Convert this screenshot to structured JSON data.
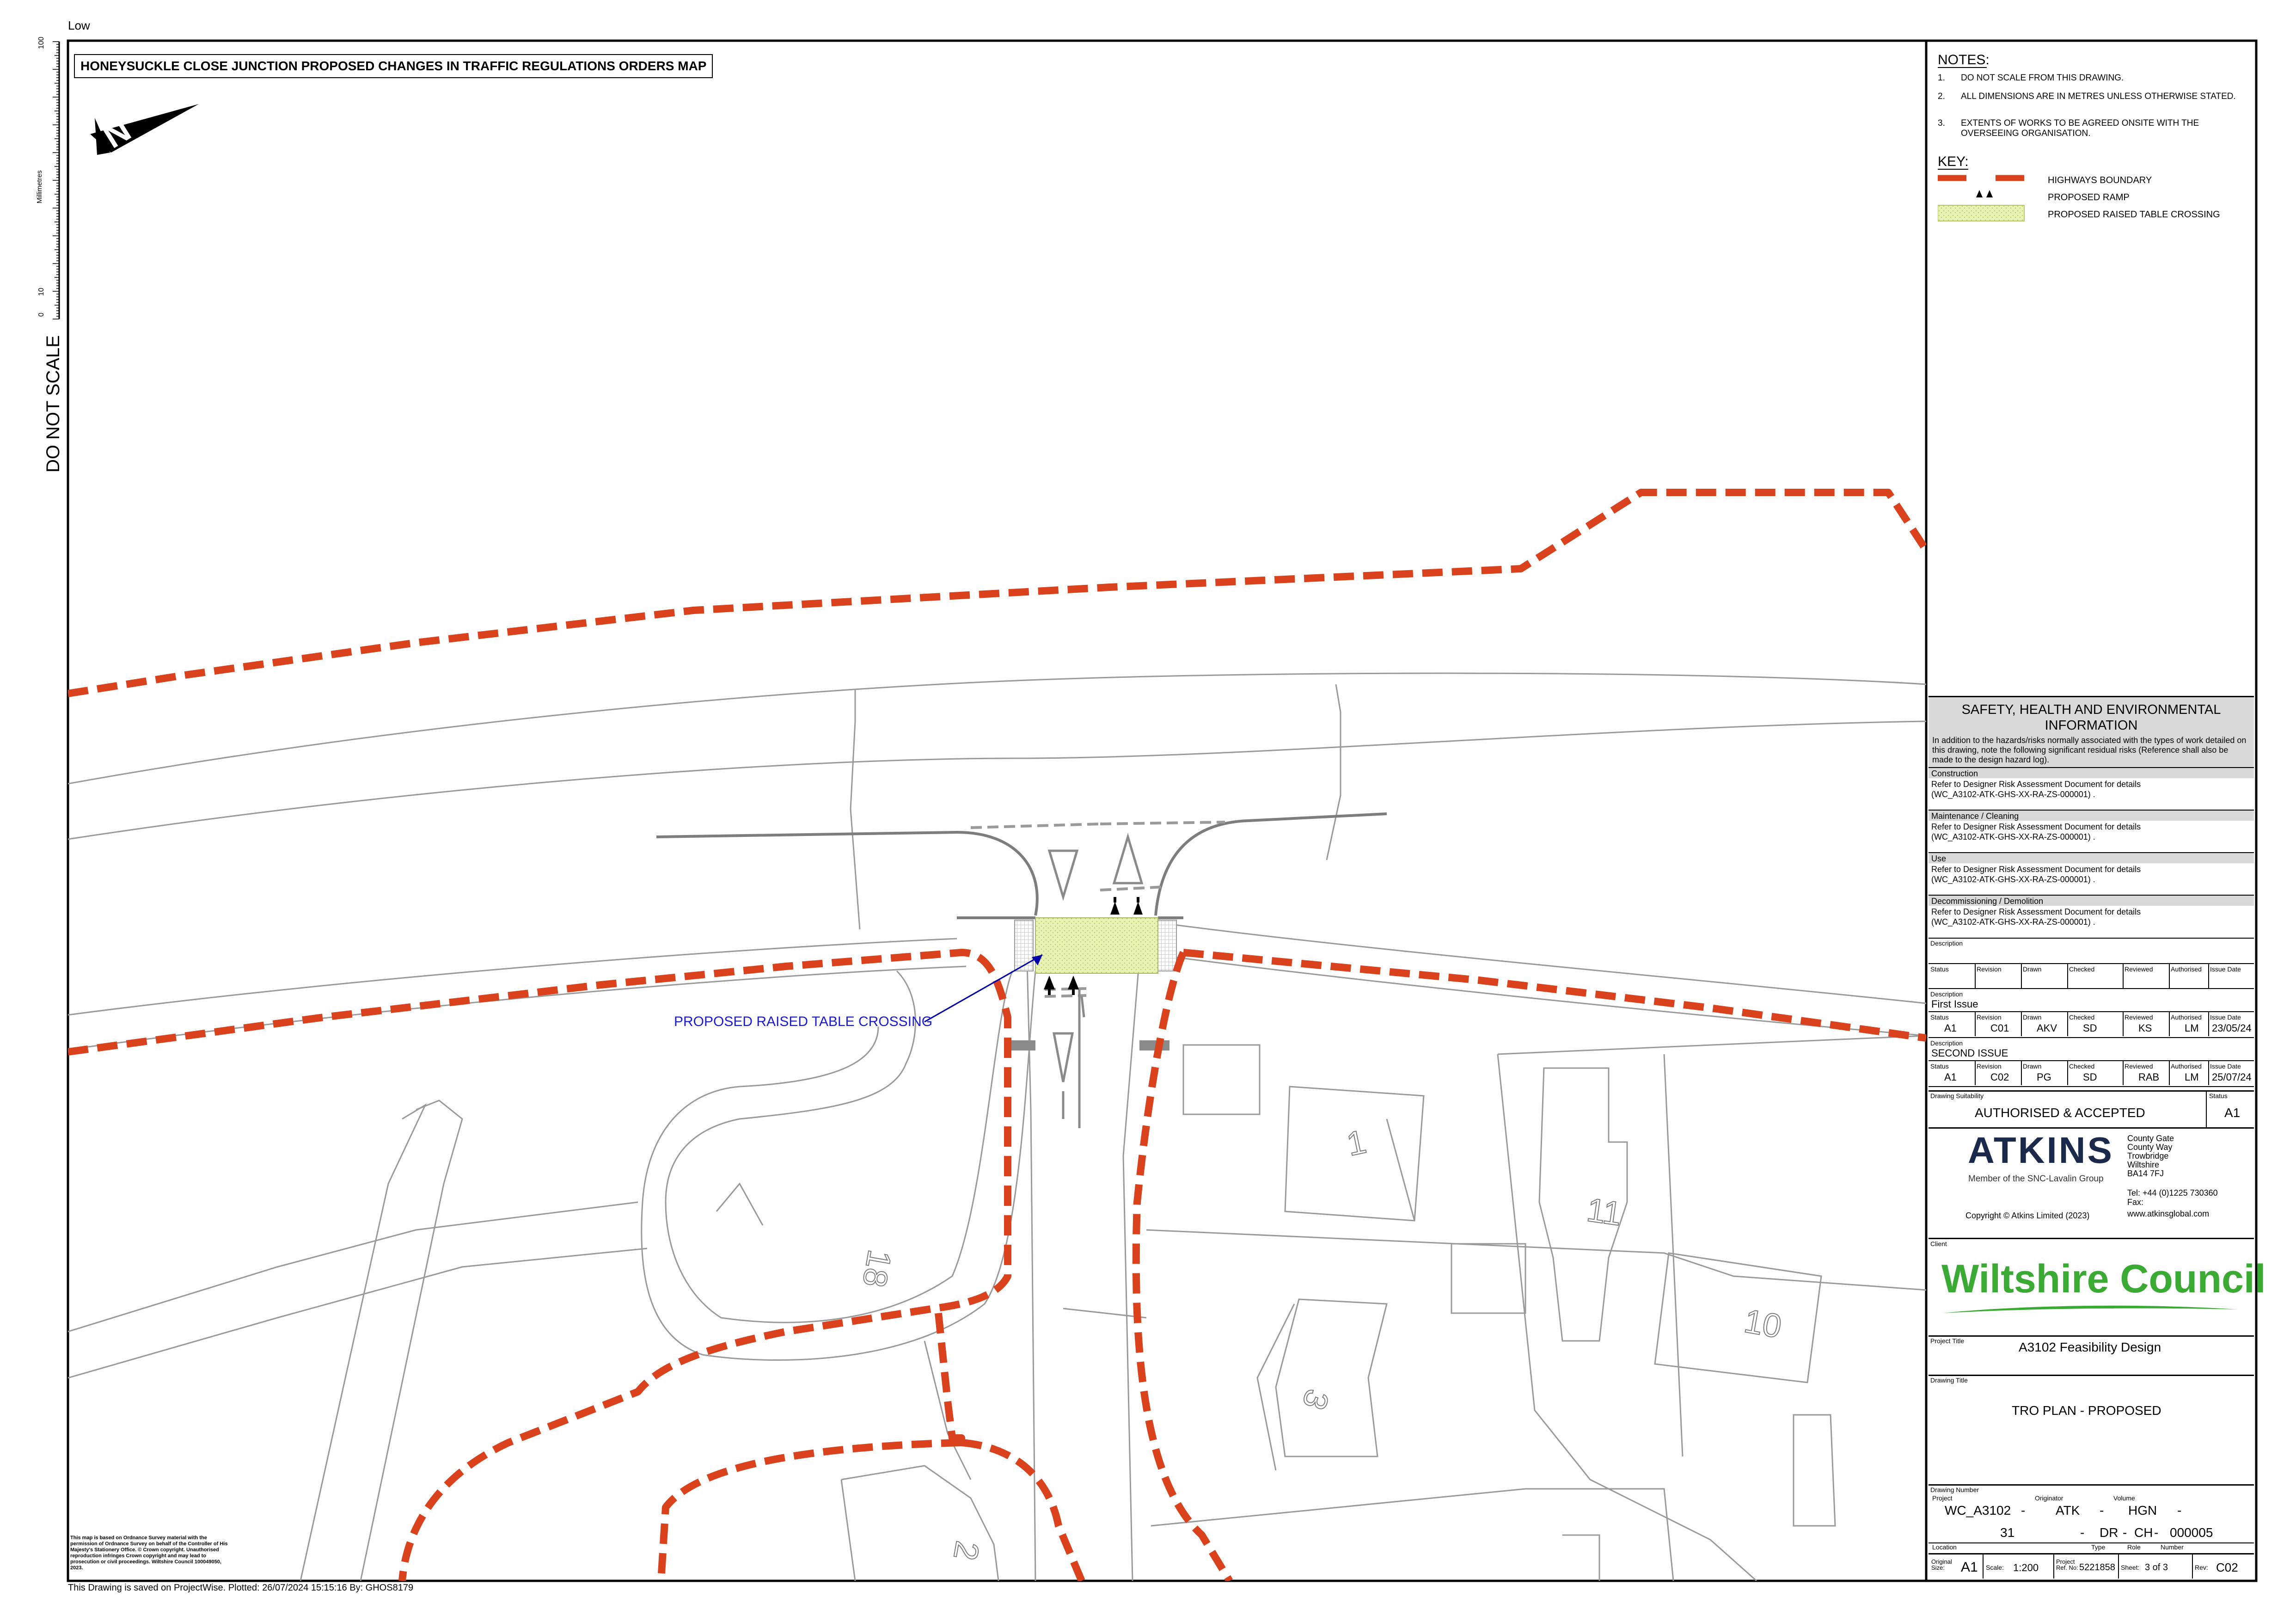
{
  "sheet": {
    "top_left_label": "Low",
    "do_not_scale": "DO NOT SCALE",
    "scale_bar_unit": "Millimetres",
    "scale_bar_ticks": [
      "100",
      "10",
      "0"
    ],
    "map_title": "HONEYSUCKLE CLOSE JUNCTION PROPOSED CHANGES IN TRAFFIC REGULATIONS ORDERS MAP",
    "north_arrow_letter": "N",
    "callout_label": "PROPOSED RAISED TABLE CROSSING",
    "footer": "This Drawing is saved on ProjectWise.   Plotted:  26/07/2024 15:15:16  By:  GHOS8179",
    "os_copyright": "This map is based on Ordnance Survey material with the permission of Ordnance Survey on behalf of the Controller of His Majesty's Stationery Office. © Crown copyright. Unauthorised reproduction infringes Crown copyright and may lead to prosecution or civil proceedings. Wiltshire Council 100049050, 2023.",
    "plot_numbers": [
      "1",
      "11",
      "10",
      "3",
      "2",
      "18"
    ]
  },
  "notes": {
    "heading": "NOTES:",
    "items": [
      {
        "num": "1.",
        "text": "DO NOT SCALE FROM THIS DRAWING."
      },
      {
        "num": "2.",
        "text": "ALL DIMENSIONS ARE IN METRES UNLESS OTHERWISE STATED."
      },
      {
        "num": "3.",
        "text": "EXTENTS OF WORKS TO BE AGREED ONSITE WITH THE OVERSEEING ORGANISATION."
      }
    ]
  },
  "key": {
    "heading": "KEY:",
    "items": [
      {
        "label": "HIGHWAYS BOUNDARY",
        "color": "#d9421c"
      },
      {
        "label": "PROPOSED RAMP",
        "color": "#000000"
      },
      {
        "label": "PROPOSED RAISED TABLE CROSSING",
        "color": "#e8f2b4"
      }
    ]
  },
  "she": {
    "heading": "SAFETY, HEALTH AND ENVIRONMENTAL INFORMATION",
    "intro": "In addition to the hazards/risks normally associated with the types of work detailed on this drawing, note the following significant residual risks (Reference shall also be made to the design hazard log).",
    "sections": [
      {
        "title": "Construction",
        "line1": "Refer to Designer Risk Assessment Document for details",
        "line2": "(WC_A3102-ATK-GHS-XX-RA-ZS-000001) ."
      },
      {
        "title": "Maintenance / Cleaning",
        "line1": "Refer to Designer Risk Assessment Document for details",
        "line2": "(WC_A3102-ATK-GHS-XX-RA-ZS-000001) ."
      },
      {
        "title": "Use",
        "line1": "Refer to Designer Risk Assessment Document for details",
        "line2": "(WC_A3102-ATK-GHS-XX-RA-ZS-000001) ."
      },
      {
        "title": "Decommissioning / Demolition",
        "line1": "Refer to Designer Risk Assessment Document for details",
        "line2": "(WC_A3102-ATK-GHS-XX-RA-ZS-000001) ."
      }
    ]
  },
  "revisions": {
    "desc_label": "Description",
    "headers": [
      "Status",
      "Revision",
      "Drawn",
      "Checked",
      "Reviewed",
      "Authorised",
      "Issue Date"
    ],
    "rows": [
      {
        "description": "First Issue",
        "values": [
          "A1",
          "C01",
          "AKV",
          "SD",
          "KS",
          "LM",
          "23/05/24"
        ]
      },
      {
        "description": "SECOND ISSUE",
        "values": [
          "A1",
          "C02",
          "PG",
          "SD",
          "RAB",
          "LM",
          "25/07/24"
        ]
      }
    ]
  },
  "suitability": {
    "label": "Drawing Suitability",
    "value": "AUTHORISED & ACCEPTED",
    "status_label": "Status",
    "status_value": "A1"
  },
  "atkins": {
    "logo": "ATKINS",
    "tagline": "Member of the SNC-Lavalin Group",
    "address": [
      "County Gate",
      "County Way",
      "Trowbridge",
      "Wiltshire",
      "BA14 7FJ"
    ],
    "tel": "Tel: +44 (0)1225 730360",
    "fax": "Fax:",
    "web": "www.atkinsglobal.com",
    "copyright": "Copyright  ©  Atkins Limited (2023)"
  },
  "client": {
    "label": "Client",
    "name": "Wiltshire Council",
    "color": "#3aaa35"
  },
  "project": {
    "label": "Project Title",
    "value": "A3102 Feasibility Design"
  },
  "drawing_title": {
    "label": "Drawing Title",
    "value": "TRO PLAN - PROPOSED"
  },
  "drawing_number": {
    "label": "Drawing Number",
    "labels": {
      "project": "Project",
      "originator": "Originator",
      "volume": "Volume",
      "location": "Location",
      "type": "Type",
      "role": "Role",
      "number": "Number"
    },
    "project": "WC_A3102",
    "originator": "ATK",
    "volume": "HGN",
    "location": "31",
    "type": "DR",
    "role": "CH",
    "number": "000005",
    "dash": "-"
  },
  "footer_cells": {
    "original_size_label": "Original Size:",
    "original_size": "A1",
    "scale_label": "Scale:",
    "scale": "1:200",
    "project_ref_label": "Project Ref. No:",
    "project_ref": "5221858",
    "sheet_label": "Sheet:",
    "sheet": "3 of 3",
    "rev_label": "Rev:",
    "rev": "C02"
  }
}
